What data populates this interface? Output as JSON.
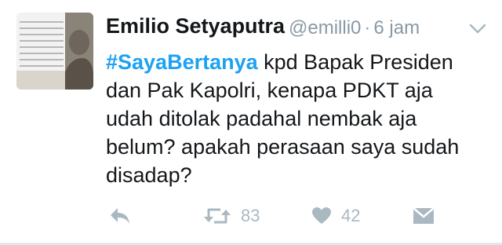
{
  "tweet": {
    "author_name": "Emilio Setyaputra",
    "handle": "@emilli0",
    "separator": "·",
    "time_ago": "6 jam",
    "hashtag": "#SayaBertanya",
    "text_line1_rest": " kpd Bapak Presiden",
    "text_line2": "dan Pak Kapolri, kenapa PDKT aja",
    "text_line3": "udah ditolak padahal nembak aja",
    "text_line4": "belum? apakah perasaan saya sudah",
    "text_line5": "disadap?"
  },
  "actions": {
    "reply_icon": "reply-icon",
    "retweet_icon": "retweet-icon",
    "retweet_count": "83",
    "like_icon": "heart-icon",
    "like_count": "42",
    "dm_icon": "direct-message-icon"
  },
  "colors": {
    "hashtag": "#1da1f2",
    "text": "#14171a",
    "meta": "#8899a6",
    "icons": "#aab8c2"
  }
}
